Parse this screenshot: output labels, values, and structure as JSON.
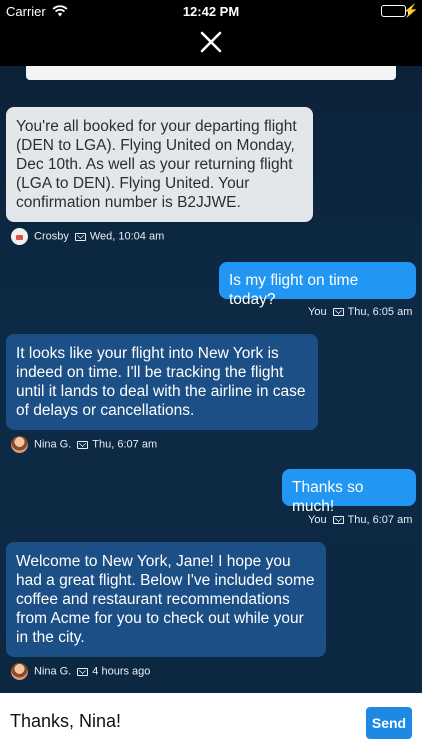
{
  "status_bar": {
    "carrier": "Carrier",
    "time": "12:42 PM"
  },
  "header": {
    "close_icon": "close-icon"
  },
  "messages": [
    {
      "id": "m1",
      "text": "You're all booked for your departing flight (DEN to LGA). Flying United on Monday, Dec 10th. As well as your returning flight (LGA to DEN). Flying United. Your confirmation number is B2JJWE.",
      "sender": "Crosby",
      "time": "Wed, 10:04 am"
    },
    {
      "id": "m2",
      "text": "Is my flight on time today?",
      "sender": "You",
      "time": "Thu, 6:05 am"
    },
    {
      "id": "m3",
      "text": "It looks like your flight into New York is indeed on time. I'll be tracking the flight until it lands to deal with the airline in case of delays or cancellations.",
      "sender": "Nina G.",
      "time": "Thu, 6:07 am"
    },
    {
      "id": "m4",
      "text": "Thanks so much!",
      "sender": "You",
      "time": "Thu, 6:07 am"
    },
    {
      "id": "m5",
      "text": "Welcome to New York, Jane! I hope you had a great flight. Below I've included some coffee and restaurant recommendations from Acme for you to check out while your in the city.",
      "sender": "Nina G.",
      "time": "4 hours ago"
    }
  ],
  "composer": {
    "value": "Thanks, Nina!",
    "send_label": "Send"
  },
  "colors": {
    "accent": "#2196f3",
    "agent_bubble": "#1b4f86",
    "bot_bubble": "#e4e7ea"
  }
}
